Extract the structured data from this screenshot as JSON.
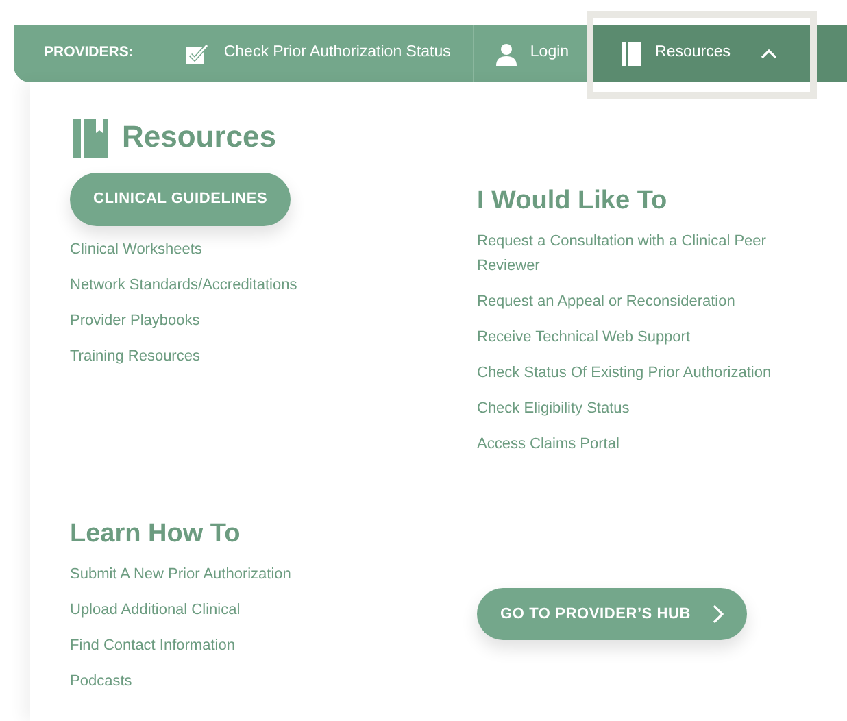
{
  "nav": {
    "label": "PROVIDERS:",
    "items": [
      {
        "label": "Check Prior Authorization Status",
        "kind": "status",
        "selected": false
      },
      {
        "label": "Login",
        "kind": "login",
        "selected": false
      },
      {
        "label": "Resources",
        "kind": "dropdown",
        "selected": true,
        "expanded": true
      }
    ]
  },
  "panel": {
    "title": "Resources",
    "primary_button": "CLINICAL GUIDELINES",
    "resource_links": [
      "Clinical Worksheets",
      "Network Standards/Accreditations",
      "Provider Playbooks",
      "Training Resources"
    ],
    "would_like_to": {
      "heading": "I Would Like To",
      "links": [
        "Request a Consultation with a Clinical Peer Reviewer",
        "Request an Appeal or Reconsideration",
        "Receive Technical Web Support",
        "Check Status Of Existing Prior Authorization",
        "Check Eligibility Status",
        "Access Claims Portal"
      ]
    },
    "learn_how_to": {
      "heading": "Learn How To",
      "links": [
        "Submit A New Prior Authorization",
        "Upload Additional Clinical",
        "Find Contact Information",
        "Podcasts"
      ]
    },
    "hub_button": "GO TO PROVIDER’S HUB"
  }
}
